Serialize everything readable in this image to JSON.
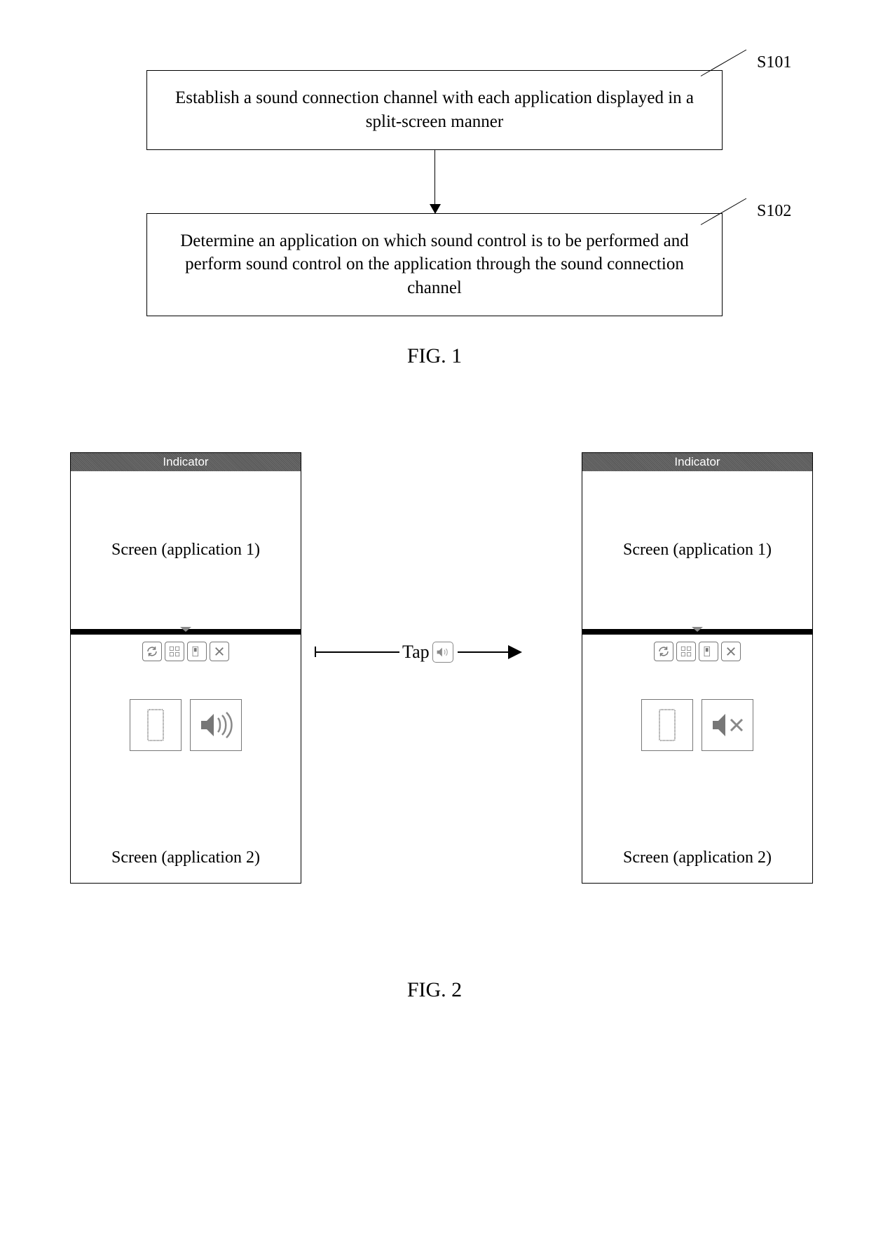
{
  "fig1": {
    "box1": {
      "text": "Establish a sound connection channel with each application displayed in a split-screen manner",
      "label": "S101"
    },
    "box2": {
      "text": "Determine an application on which sound control is to be performed and perform sound control on the application through the sound connection channel",
      "label": "S102"
    },
    "caption": "FIG. 1"
  },
  "fig2": {
    "indicator": "Indicator",
    "screen1": "Screen (application 1)",
    "screen2": "Screen (application 2)",
    "tap": "Tap",
    "caption": "FIG. 2",
    "left_sound_state": "on",
    "right_sound_state": "muted"
  }
}
